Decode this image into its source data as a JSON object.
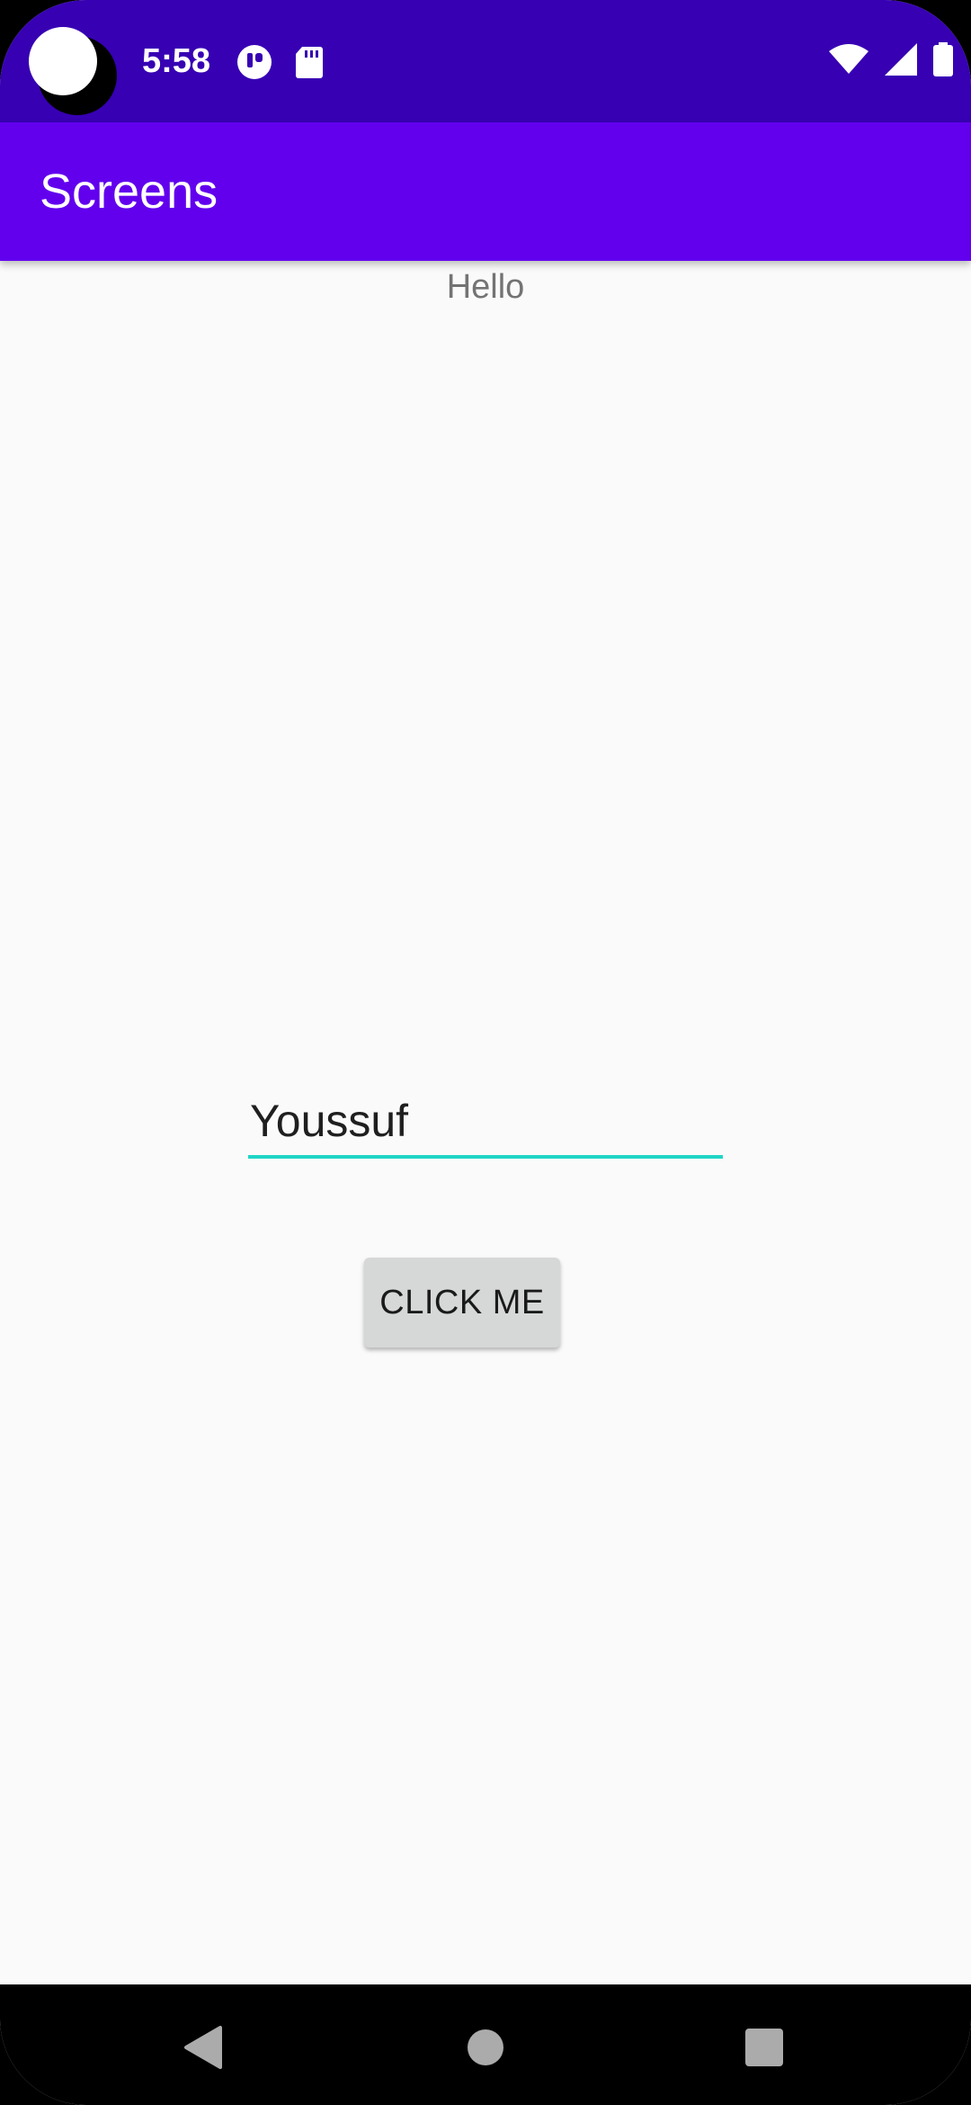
{
  "status_bar": {
    "time": "5:58",
    "icons": [
      "camera-cutout",
      "podcast-app-icon",
      "sd-card-icon",
      "wifi-icon",
      "cellular-signal-icon",
      "battery-icon"
    ],
    "background_color": "#3700b3"
  },
  "app_bar": {
    "title": "Screens",
    "background_color": "#6200ee"
  },
  "main": {
    "greeting": "Hello",
    "name_input": {
      "value": "Youssuf",
      "placeholder": "",
      "underline_color": "#1fd6c6"
    },
    "click_button": {
      "label": "CLICK ME"
    }
  },
  "nav_bar": {
    "buttons": [
      "back-icon",
      "home-icon",
      "recents-icon"
    ]
  }
}
